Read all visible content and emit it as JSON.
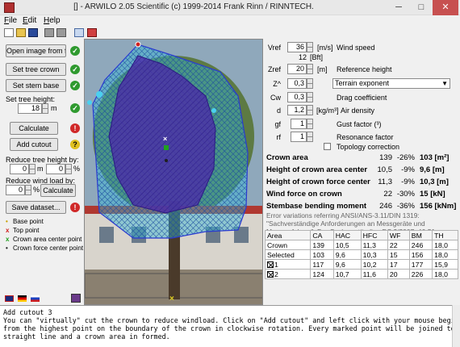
{
  "window": {
    "title": "[] - ARWILO 2.05 Scientific (c) 1999-2014 Frank Rinn / RINNTECH.",
    "minimize": "─",
    "maximize": "□",
    "close": "✕"
  },
  "menu": {
    "file_u": "F",
    "file_rest": "ile",
    "edit_u": "E",
    "edit_rest": "dit",
    "help_u": "H",
    "help_rest": "elp"
  },
  "left": {
    "open_image": "Open image from file...",
    "set_tree_crown": "Set tree crown",
    "set_stem_base": "Set stem base",
    "set_tree_height_label": "Set tree height:",
    "tree_height_value": "18",
    "tree_height_unit": "m",
    "calculate": "Calculate",
    "add_cutout": "Add cutout",
    "reduce_height_label": "Reduce tree height by:",
    "reduce_height_m": "0",
    "reduce_height_m_unit": "m",
    "reduce_height_pct": "0",
    "reduce_height_pct_unit": "%",
    "reduce_load_label": "Reduce wind load by:",
    "reduce_load_value": "0",
    "reduce_load_unit": "%",
    "calculate_small": "Calculate",
    "save_dataset": "Save dataset...",
    "legend": [
      {
        "mark": "•",
        "color": "#c8a000",
        "text": "Base point"
      },
      {
        "mark": "x",
        "color": "#d02020",
        "text": "Top point"
      },
      {
        "mark": "x",
        "color": "#20a020",
        "text": "Crown area center point"
      },
      {
        "mark": "•",
        "color": "#202020",
        "text": "Crown force center point"
      }
    ],
    "status": {
      "ok": "✓",
      "err": "!",
      "warn": "?"
    }
  },
  "right": {
    "vref_label": "Vref",
    "vref_value": "36",
    "vref_unit": "[m/s]",
    "vref_desc": "Wind speed",
    "bft_value": "12",
    "bft_unit": "[Bft]",
    "zref_label": "Zref",
    "zref_value": "20",
    "zref_unit": "[m]",
    "zref_desc": "Reference height",
    "z_label": "Z^",
    "z_value": "0,3",
    "z_dropdown": "Terrain exponent",
    "cw_label": "Cw",
    "cw_value": "0,3",
    "cw_desc": "Drag coefficient",
    "d_label": "d",
    "d_value": "1,2",
    "d_unit": "[kg/m³]",
    "d_desc": "Air density",
    "gf_label": "gf",
    "gf_value": "1",
    "gf_desc": "Gust factor (³)",
    "rf_label": "rf",
    "rf_value": "1",
    "rf_desc": "Resonance factor",
    "topology": "Topology correction",
    "results": [
      {
        "label": "Crown area",
        "v1": "139",
        "v2": "-26%",
        "v3": "103 [m²]"
      },
      {
        "label": "Height of crown area center",
        "v1": "10,5",
        "v2": "-9%",
        "v3": "9,6 [m]"
      },
      {
        "label": "Height of crown force center",
        "v1": "11,3",
        "v2": "-9%",
        "v3": "10,3 [m]"
      },
      {
        "label": "Wind force on crown",
        "v1": "22",
        "v2": "-30%",
        "v3": "15 [kN]"
      },
      {
        "label": "Stembase bending moment",
        "v1": "246",
        "v2": "-36%",
        "v3": "156 [kNm]"
      }
    ],
    "note_lines": [
      "Error variations referring ANSI/ANS-3.11/DIN 1319:",
      "\"Sachverständige Anforderungen an Messgeräte und",
      "Messverfahren\", Der Sachverständige DS 3/2007, 46-51."
    ]
  },
  "table": {
    "headers": [
      "Area",
      "CA",
      "HAC",
      "HFC",
      "WF",
      "BM",
      "TH"
    ],
    "rows": [
      {
        "area": "Crown",
        "ca": "139",
        "hac": "10,5",
        "hfc": "11,3",
        "wf": "22",
        "bm": "246",
        "th": "18,0",
        "checkbox": false
      },
      {
        "area": "Selected",
        "ca": "103",
        "hac": "9,6",
        "hfc": "10,3",
        "wf": "15",
        "bm": "156",
        "th": "18,0",
        "checkbox": false
      },
      {
        "area": "1",
        "ca": "117",
        "hac": "9,6",
        "hfc": "10,2",
        "wf": "17",
        "bm": "177",
        "th": "15,9",
        "checkbox": true
      },
      {
        "area": "2",
        "ca": "124",
        "hac": "10,7",
        "hfc": "11,6",
        "wf": "20",
        "bm": "226",
        "th": "18,0",
        "checkbox": true
      }
    ]
  },
  "help": {
    "lines": [
      "Add cutout 3",
      "You can \"virtually\" cut the crown to reduce windload. Click on \"Add cutout\" and left click with your mouse beginning",
      "from the highest point on the boundary of the crown in clockwise rotation. Every marked point will be joined to a",
      "straight line and a crown area in formed."
    ]
  },
  "colors": {
    "crown_outline": "#2a3ad0",
    "cutout_fill": "#30c0d8",
    "selected_fill": "#3a2a9a",
    "ok": "#2f9a2f",
    "err": "#d02828",
    "warn": "#e0c020"
  }
}
